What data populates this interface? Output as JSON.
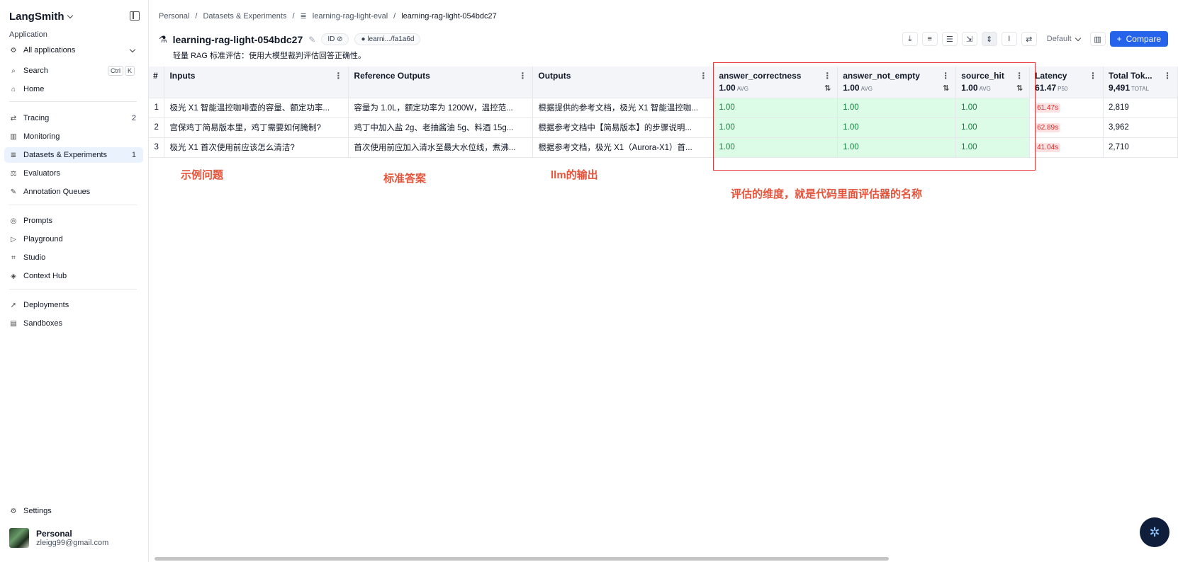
{
  "sidebar": {
    "brand": "LangSmith",
    "section_label": "Application",
    "app_selector": "All applications",
    "search": {
      "label": "Search",
      "kbd1": "Ctrl",
      "kbd2": "K"
    },
    "home": "Home",
    "tracing": {
      "label": "Tracing",
      "count": "2"
    },
    "monitoring": "Monitoring",
    "datasets": {
      "label": "Datasets & Experiments",
      "count": "1"
    },
    "evaluators": "Evaluators",
    "annotation_queues": "Annotation Queues",
    "prompts": "Prompts",
    "playground": "Playground",
    "studio": "Studio",
    "context_hub": "Context Hub",
    "deployments": "Deployments",
    "sandboxes": "Sandboxes",
    "settings": "Settings",
    "user": {
      "name": "Personal",
      "email": "zleigg99@gmail.com"
    }
  },
  "breadcrumb": [
    "Personal",
    "Datasets & Experiments",
    "learning-rag-light-eval",
    "learning-rag-light-054bdc27"
  ],
  "header": {
    "title": "learning-rag-light-054bdc27",
    "id_pill": "ID",
    "repo_pill": "learni.../fa1a6d",
    "description": "轻量 RAG 标准评估：使用大模型裁判评估回答正确性。",
    "view_select": "Default",
    "compare": "Compare"
  },
  "table": {
    "headers": {
      "num": "#",
      "inputs": "Inputs",
      "reference": "Reference Outputs",
      "outputs": "Outputs",
      "answer_correctness": {
        "label": "answer_correctness",
        "value": "1.00",
        "unit": "AVG"
      },
      "answer_not_empty": {
        "label": "answer_not_empty",
        "value": "1.00",
        "unit": "AVG"
      },
      "source_hit": {
        "label": "source_hit",
        "value": "1.00",
        "unit": "AVG"
      },
      "latency": {
        "label": "Latency",
        "value": "61.47",
        "unit": "P50"
      },
      "total_tokens": {
        "label": "Total Tok...",
        "value": "9,491",
        "unit": "TOTAL"
      }
    },
    "rows": [
      {
        "num": "1",
        "input": "极光 X1 智能温控咖啡壶的容量、额定功率...",
        "reference": "容量为 1.0L，额定功率为 1200W，温控范...",
        "output": "根据提供的参考文档，极光 X1 智能温控咖...",
        "ac": "1.00",
        "ane": "1.00",
        "sh": "1.00",
        "latency": "61.47s",
        "tokens": "2,819"
      },
      {
        "num": "2",
        "input": "宫保鸡丁简易版本里，鸡丁需要如何腌制?",
        "reference": "鸡丁中加入盐 2g、老抽酱油 5g、料酒 15g...",
        "output": "根据参考文档中【简易版本】的步骤说明...",
        "ac": "1.00",
        "ane": "1.00",
        "sh": "1.00",
        "latency": "62.89s",
        "tokens": "3,962"
      },
      {
        "num": "3",
        "input": "极光 X1 首次使用前应该怎么清洁?",
        "reference": "首次使用前应加入清水至最大水位线，煮沸...",
        "output": "根据参考文档，极光 X1（Aurora-X1）首...",
        "ac": "1.00",
        "ane": "1.00",
        "sh": "1.00",
        "latency": "41.04s",
        "tokens": "2,710"
      }
    ]
  },
  "annotations": {
    "inputs": "示例问题",
    "reference": "标准答案",
    "outputs": "llm的输出",
    "evaluators": "评估的维度，就是代码里面评估器的名称"
  }
}
